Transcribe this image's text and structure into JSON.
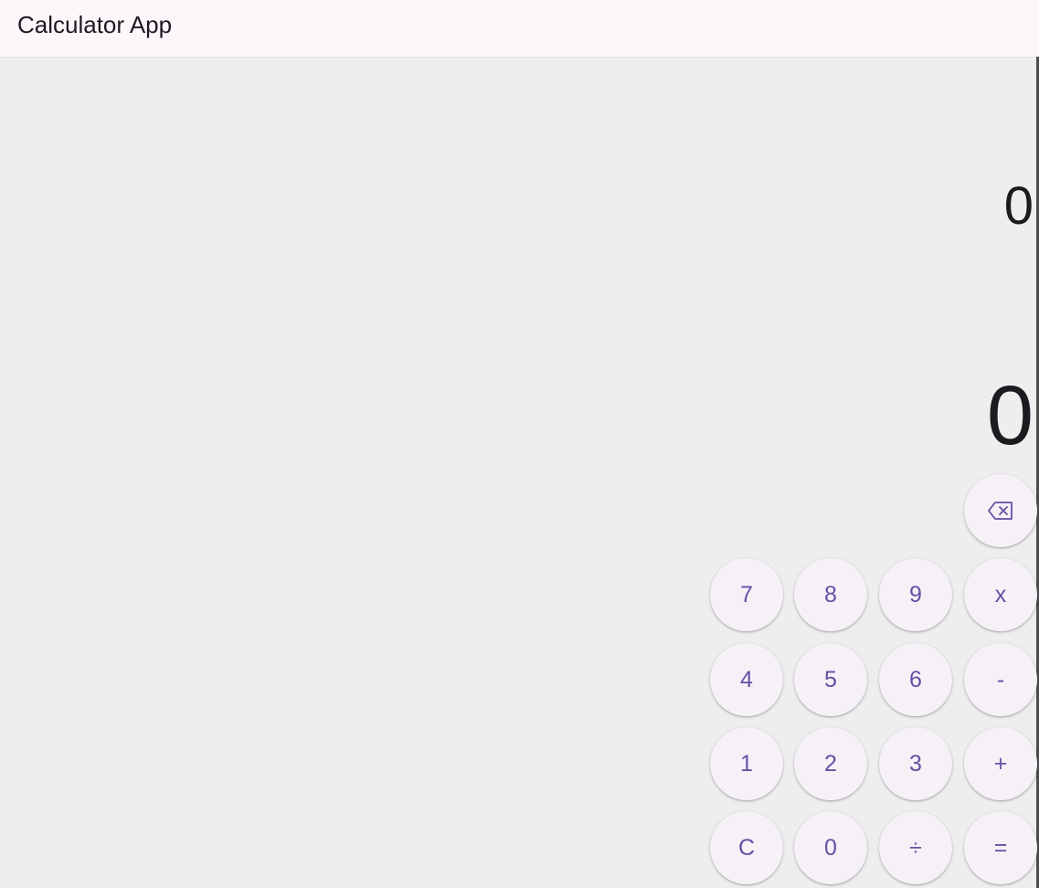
{
  "app_bar": {
    "title": "Calculator App"
  },
  "display": {
    "expression": "0",
    "result": "0"
  },
  "keypad": {
    "backspace": {
      "icon": "backspace-icon"
    },
    "keys": {
      "seven": "7",
      "eight": "8",
      "nine": "9",
      "multiply": "x",
      "four": "4",
      "five": "5",
      "six": "6",
      "subtract": "-",
      "one": "1",
      "two": "2",
      "three": "3",
      "add": "+",
      "clear": "C",
      "zero": "0",
      "divide": "÷",
      "equals": "="
    }
  },
  "colors": {
    "app_bar_bg": "#fdf7fc",
    "body_bg": "#eeeeee",
    "key_bg": "#f5f1f7",
    "key_text": "#6750a4",
    "display_text": "#1d1b20"
  }
}
